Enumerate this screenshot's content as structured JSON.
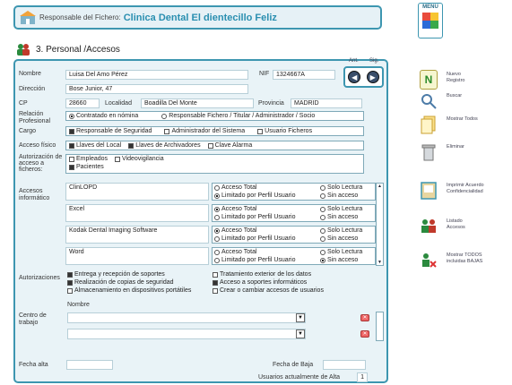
{
  "header": {
    "label": "Responsable del Fichero:",
    "value": "Clinica Dental El dientecillo Feliz"
  },
  "menu": {
    "label": "MENU"
  },
  "section": {
    "title": "3. Personal /Accesos"
  },
  "nav": {
    "prev": "Ant.",
    "next": "Sig."
  },
  "form": {
    "nombre": {
      "label": "Nombre",
      "value": "Luisa Del Amo Pérez"
    },
    "nif": {
      "label": "NIF",
      "value": "1324667A"
    },
    "direccion": {
      "label": "Dirección",
      "value": "Bose Junior, 47"
    },
    "cp": {
      "label": "CP",
      "value": "28660"
    },
    "localidad": {
      "label": "Localidad",
      "value": "Boadilla Del Monte"
    },
    "provincia": {
      "label": "Provincia",
      "value": "MADRID"
    },
    "relacion": {
      "label": "Relación Profesional",
      "opt1": "Contratado en nómina",
      "opt2": "Responsable Fichero / Titular / Administrador / Socio"
    },
    "cargo": {
      "label": "Cargo",
      "opt1": "Responsable de Seguridad",
      "opt2": "Administrador del Sistema",
      "opt3": "Usuario Ficheros"
    },
    "acceso_fisico": {
      "label": "Acceso físico",
      "opt1": "Llaves del Local",
      "opt2": "Llaves de Archivadores",
      "opt3": "Clave Alarma"
    },
    "autorizacion": {
      "label": "Autorización de acceso a ficheros:",
      "opt1": "Empleados",
      "opt2": "Videovigilancia",
      "opt3": "Pacientes"
    },
    "accesos": {
      "label": "Accesos informático",
      "opt_total": "Acceso Total",
      "opt_lectura": "Solo Lectura",
      "opt_perfil": "Limitado por Perfil  Usuario",
      "opt_sin": "Sin acceso",
      "rows": [
        {
          "name": "ClinLOPD"
        },
        {
          "name": "Excel"
        },
        {
          "name": "Kodak Dental Imaging Software"
        },
        {
          "name": "Word"
        }
      ]
    },
    "autorizaciones": {
      "label": "Autorizaciones",
      "a1": "Entrega y recepción de soportes",
      "a2": "Realización de copias de seguridad",
      "a3": "Almacenamiento en dispositivos portátiles",
      "b1": "Tratamiento exterior de los datos",
      "b2": "Acceso a soportes informáticos",
      "b3": "Crear o cambiar accesos de usuarios"
    },
    "centro": {
      "label": "Centro de trabajo",
      "col": "Nombre"
    },
    "fecha_alta": {
      "label": "Fecha alta",
      "value": ""
    },
    "fecha_baja": {
      "label": "Fecha de Baja",
      "value": ""
    },
    "usuarios": {
      "label": "Usuarios actualmente de Alta",
      "value": "1"
    }
  },
  "sidebar": {
    "nuevo": "Nuevo Registro",
    "buscar": "Buscar",
    "mostrar": "Mostrar Todos",
    "eliminar": "Eliminar",
    "imprimir": "Imprimir Acuerdo Confidencialidad",
    "listado": "Listado Accesos",
    "bajas": "Mostrar TODOS incluidas BAJAS"
  }
}
